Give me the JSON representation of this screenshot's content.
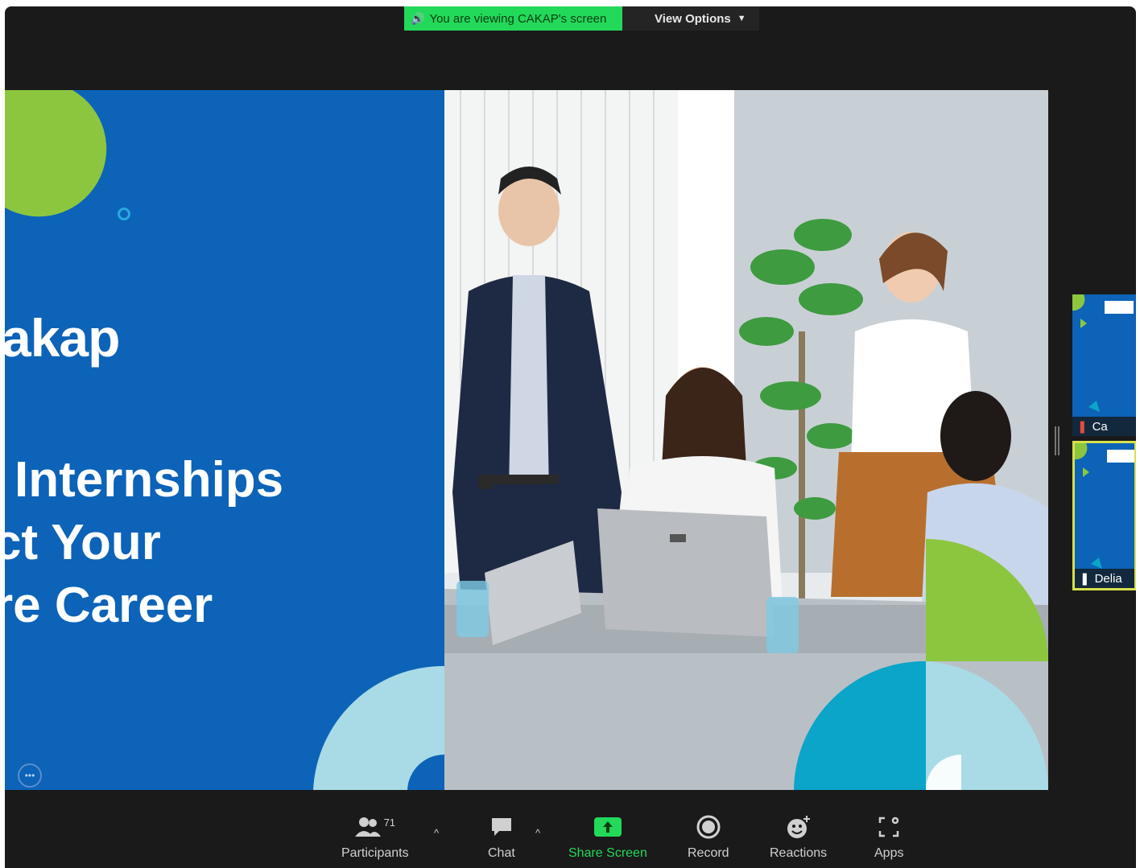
{
  "banner": {
    "viewing_text": "You are viewing CAKAP's screen",
    "view_options": "View Options"
  },
  "slide": {
    "brand_text": "akap",
    "headline": [
      "Internships",
      "ct Your",
      "re Career"
    ],
    "colors": {
      "blue": "#0c63b8",
      "green": "#8cc63f",
      "light_blue": "#a8dbe6",
      "teal": "#0aa5c8"
    }
  },
  "thumbnails": [
    {
      "name": "Ca"
    },
    {
      "name": "Delia"
    }
  ],
  "toolbar": {
    "participants_label": "Participants",
    "participants_count": "71",
    "chat_label": "Chat",
    "share_label": "Share Screen",
    "record_label": "Record",
    "reactions_label": "Reactions",
    "apps_label": "Apps"
  },
  "icons": [
    "speaker-icon",
    "chevron-down-icon",
    "participants-icon",
    "chat-icon",
    "share-screen-icon",
    "record-icon",
    "reactions-icon",
    "apps-icon",
    "pin-icon",
    "more-icon"
  ]
}
